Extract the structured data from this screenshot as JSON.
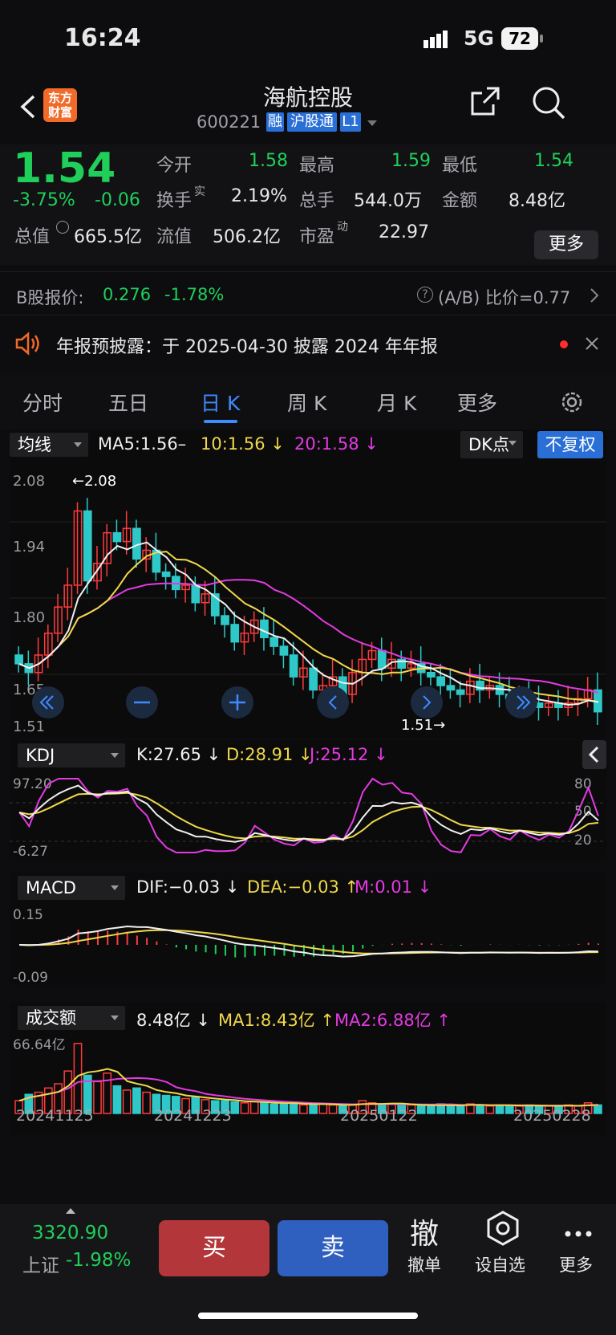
{
  "status_bar": {
    "time": "16:24",
    "network": "5G",
    "battery": "72"
  },
  "header": {
    "app_logo": "东方\n财富",
    "title": "海航控股",
    "code": "600221",
    "tags": [
      "融",
      "沪股通",
      "L1"
    ]
  },
  "quote": {
    "price": "1.54",
    "change_pct": "-3.75%",
    "change_amt": "-0.06",
    "open_label": "今开",
    "open": "1.58",
    "high_label": "最高",
    "high": "1.59",
    "low_label": "最低",
    "low": "1.54",
    "turnover_label": "换手",
    "turnover_sup": "实",
    "turnover": "2.19%",
    "volume_label": "总手",
    "volume": "544.0万",
    "amount_label": "金额",
    "amount": "8.48亿",
    "mcap_label": "总值",
    "mcap": "665.5亿",
    "float_label": "流值",
    "float": "506.2亿",
    "pe_label": "市盈",
    "pe_sup": "动",
    "pe": "22.97",
    "more_label": "更多"
  },
  "bshare": {
    "label": "B股报价:",
    "price": "0.276",
    "change": "-1.78%",
    "ratio": "(A/B) 比价=0.77"
  },
  "notice": {
    "text": "年报预披露：于 2025-04-30 披露 2024 年年报"
  },
  "tabs": [
    "分时",
    "五日",
    "日 K",
    "周 K",
    "月 K",
    "更多"
  ],
  "active_tab": "日 K",
  "kline": {
    "indicator": "均线",
    "ma5": "MA5:1.56–",
    "ma10": "10:1.56 ↓",
    "ma20": "20:1.58 ↓",
    "dk_label": "DK点",
    "fq_label": "不复权",
    "y_labels": [
      "2.08",
      "1.94",
      "1.80",
      "1.65",
      "1.51"
    ],
    "max_mark": "←2.08",
    "min_mark": "1.51→",
    "closes": [
      1.65,
      1.63,
      1.67,
      1.72,
      1.78,
      1.83,
      2.0,
      1.84,
      1.88,
      1.95,
      1.93,
      1.96,
      1.89,
      1.91,
      1.86,
      1.85,
      1.82,
      1.83,
      1.79,
      1.81,
      1.76,
      1.74,
      1.7,
      1.72,
      1.75,
      1.71,
      1.69,
      1.67,
      1.62,
      1.64,
      1.59,
      1.6,
      1.62,
      1.58,
      1.63,
      1.66,
      1.68,
      1.64,
      1.66,
      1.64,
      1.65,
      1.63,
      1.62,
      1.6,
      1.59,
      1.58,
      1.61,
      1.59,
      1.6,
      1.58,
      1.57,
      1.58,
      1.56,
      1.55,
      1.56,
      1.55,
      1.56,
      1.57,
      1.59,
      1.54
    ]
  },
  "kdj": {
    "indicator": "KDJ",
    "k": "K:27.65 ↓",
    "d": "D:28.91 ↓",
    "j": "J:25.12 ↓",
    "y_top": "97.20",
    "y_bot": "-6.27",
    "r80": "80",
    "r50": "50",
    "r20": "20"
  },
  "macd": {
    "indicator": "MACD",
    "dif": "DIF:−0.03 ↓",
    "dea": "DEA:−0.03 ↑",
    "m": "M:0.01 ↓",
    "y_top": "0.15",
    "y_bot": "-0.09"
  },
  "vol": {
    "indicator": "成交额",
    "value": "8.48亿 ↓",
    "ma1": "MA1:8.43亿 ↑",
    "ma2": "MA2:6.88亿 ↑",
    "y_top": "66.64亿",
    "values": [
      12,
      18,
      20,
      24,
      28,
      40,
      66,
      36,
      30,
      38,
      26,
      22,
      24,
      20,
      18,
      17,
      16,
      14,
      15,
      13,
      12,
      12,
      11,
      10,
      11,
      10,
      9,
      9,
      10,
      8,
      8,
      9,
      8,
      7,
      8,
      12,
      10,
      8,
      9,
      8,
      8,
      7,
      7,
      9,
      8,
      7,
      9,
      8,
      7,
      8,
      7,
      7,
      8,
      7,
      7,
      7,
      8,
      7,
      10,
      8
    ]
  },
  "x_labels": [
    "20241125",
    "20241223",
    "20250122",
    "20250228"
  ],
  "bottom": {
    "index_value": "3320.90",
    "index_name": "上证",
    "index_change": "-1.98%",
    "buy": "买",
    "sell": "卖",
    "cancel_icon": "撤",
    "cancel": "撤单",
    "watch": "设自选",
    "more": "更多"
  }
}
